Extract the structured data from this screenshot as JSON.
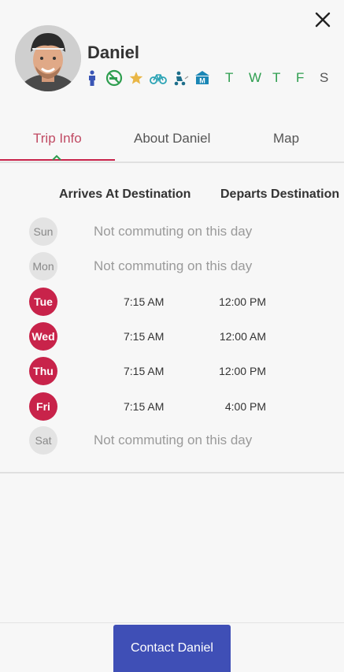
{
  "profile": {
    "name": "Daniel",
    "badges": [
      "person-icon",
      "no-smoking-icon",
      "star-icon",
      "bicycle-icon",
      "scooter-icon",
      "metro-icon"
    ],
    "days": [
      "T",
      "W",
      "T",
      "F",
      "S"
    ],
    "active_day_color": "#2e9e4f",
    "inactive_day_color": "#555555"
  },
  "tabs": [
    {
      "label": "Trip Info",
      "active": true
    },
    {
      "label": "About Daniel",
      "active": false
    },
    {
      "label": "Map",
      "active": false
    }
  ],
  "schedule": {
    "col_arrives": "Arrives At Destination",
    "col_departs": "Departs Destination",
    "rows": [
      {
        "day": "Sun",
        "commuting": false,
        "message": "Not commuting on this day"
      },
      {
        "day": "Mon",
        "commuting": false,
        "message": "Not commuting on this day"
      },
      {
        "day": "Tue",
        "commuting": true,
        "arrives": "7:15 AM",
        "departs": "12:00 PM"
      },
      {
        "day": "Wed",
        "commuting": true,
        "arrives": "7:15 AM",
        "departs": "12:00 AM"
      },
      {
        "day": "Thu",
        "commuting": true,
        "arrives": "7:15 AM",
        "departs": "12:00 PM"
      },
      {
        "day": "Fri",
        "commuting": true,
        "arrives": "7:15 AM",
        "departs": "4:00 PM"
      },
      {
        "day": "Sat",
        "commuting": false,
        "message": "Not commuting on this day"
      }
    ]
  },
  "footer": {
    "contact_label": "Contact Daniel"
  },
  "colors": {
    "accent": "#c8234a",
    "button": "#3f4fb6"
  }
}
